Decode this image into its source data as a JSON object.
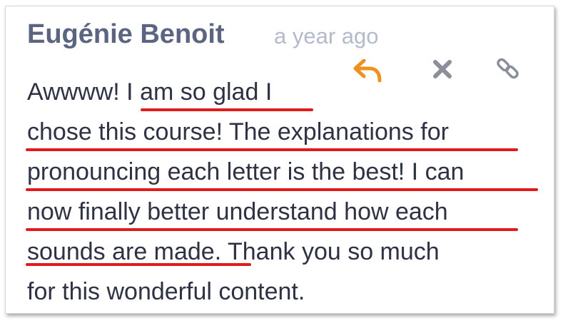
{
  "comment": {
    "author": "Eugénie Benoit",
    "timestamp": "a year ago",
    "actions": {
      "reply": "reply-icon",
      "delete": "close-icon",
      "link": "link-icon"
    },
    "body_lines": [
      "Awwww! I am so glad I",
      "chose this course! The explanations for",
      "pronouncing each letter is the best! I can",
      "now finally better understand how each",
      "sounds are made. Thank you so much",
      "for this wonderful content."
    ]
  },
  "colors": {
    "author": "#5b6480",
    "timestamp": "#b3bacb",
    "reply_icon": "#f0901e",
    "action_icons": "#8a8f9a",
    "highlight": "#e01b1b",
    "body_text": "#2e3242"
  }
}
